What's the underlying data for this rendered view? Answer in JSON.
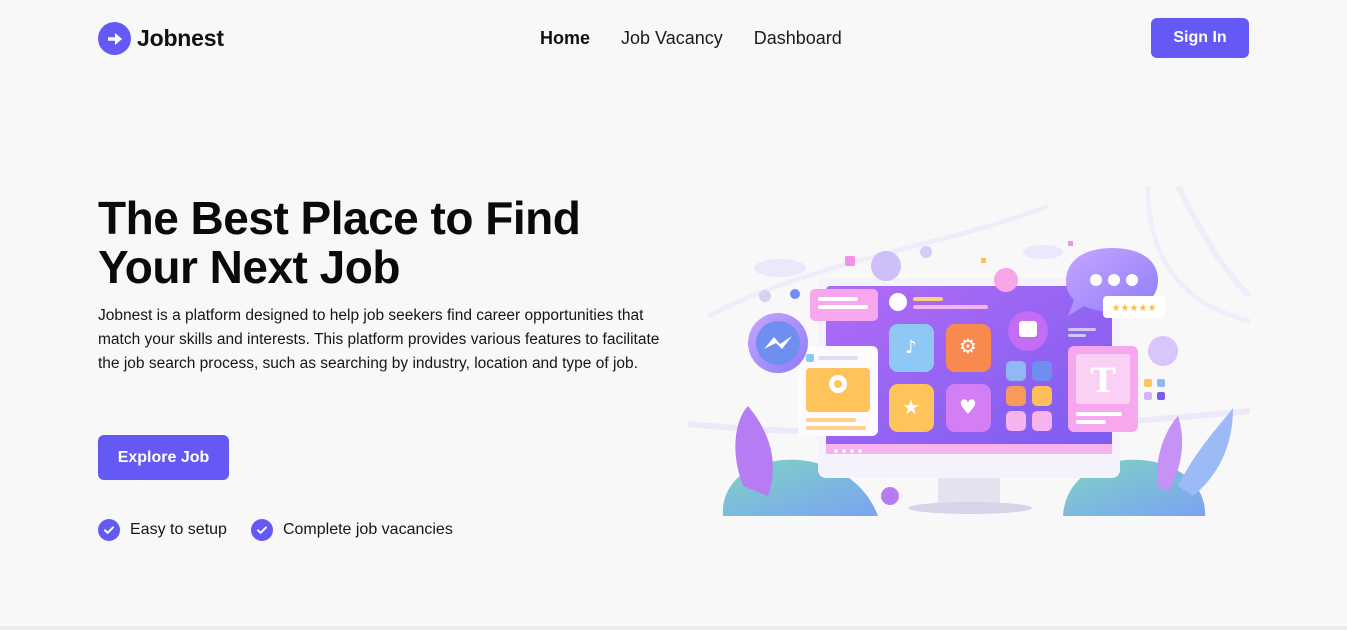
{
  "brand": {
    "name": "Jobnest",
    "logo_icon": "arrow-right-icon",
    "accent": "#6559f5"
  },
  "nav": {
    "links": [
      {
        "label": "Home",
        "active": true
      },
      {
        "label": "Job Vacancy",
        "active": false
      },
      {
        "label": "Dashboard",
        "active": false
      }
    ],
    "signin_label": "Sign In"
  },
  "hero": {
    "title": "The Best Place to Find Your Next Job",
    "description": "Jobnest is a platform designed to help job seekers find career opportunities that match your skills and interests. This platform provides various features to facilitate the job search process, such as searching by industry, location and type of job.",
    "cta_label": "Explore Job",
    "features": [
      {
        "label": "Easy to setup",
        "icon": "check-circle-icon"
      },
      {
        "label": "Complete job vacancies",
        "icon": "check-circle-icon"
      }
    ]
  },
  "illustration": {
    "monitor_letter": "T",
    "rating_stars": "★★★★★"
  }
}
